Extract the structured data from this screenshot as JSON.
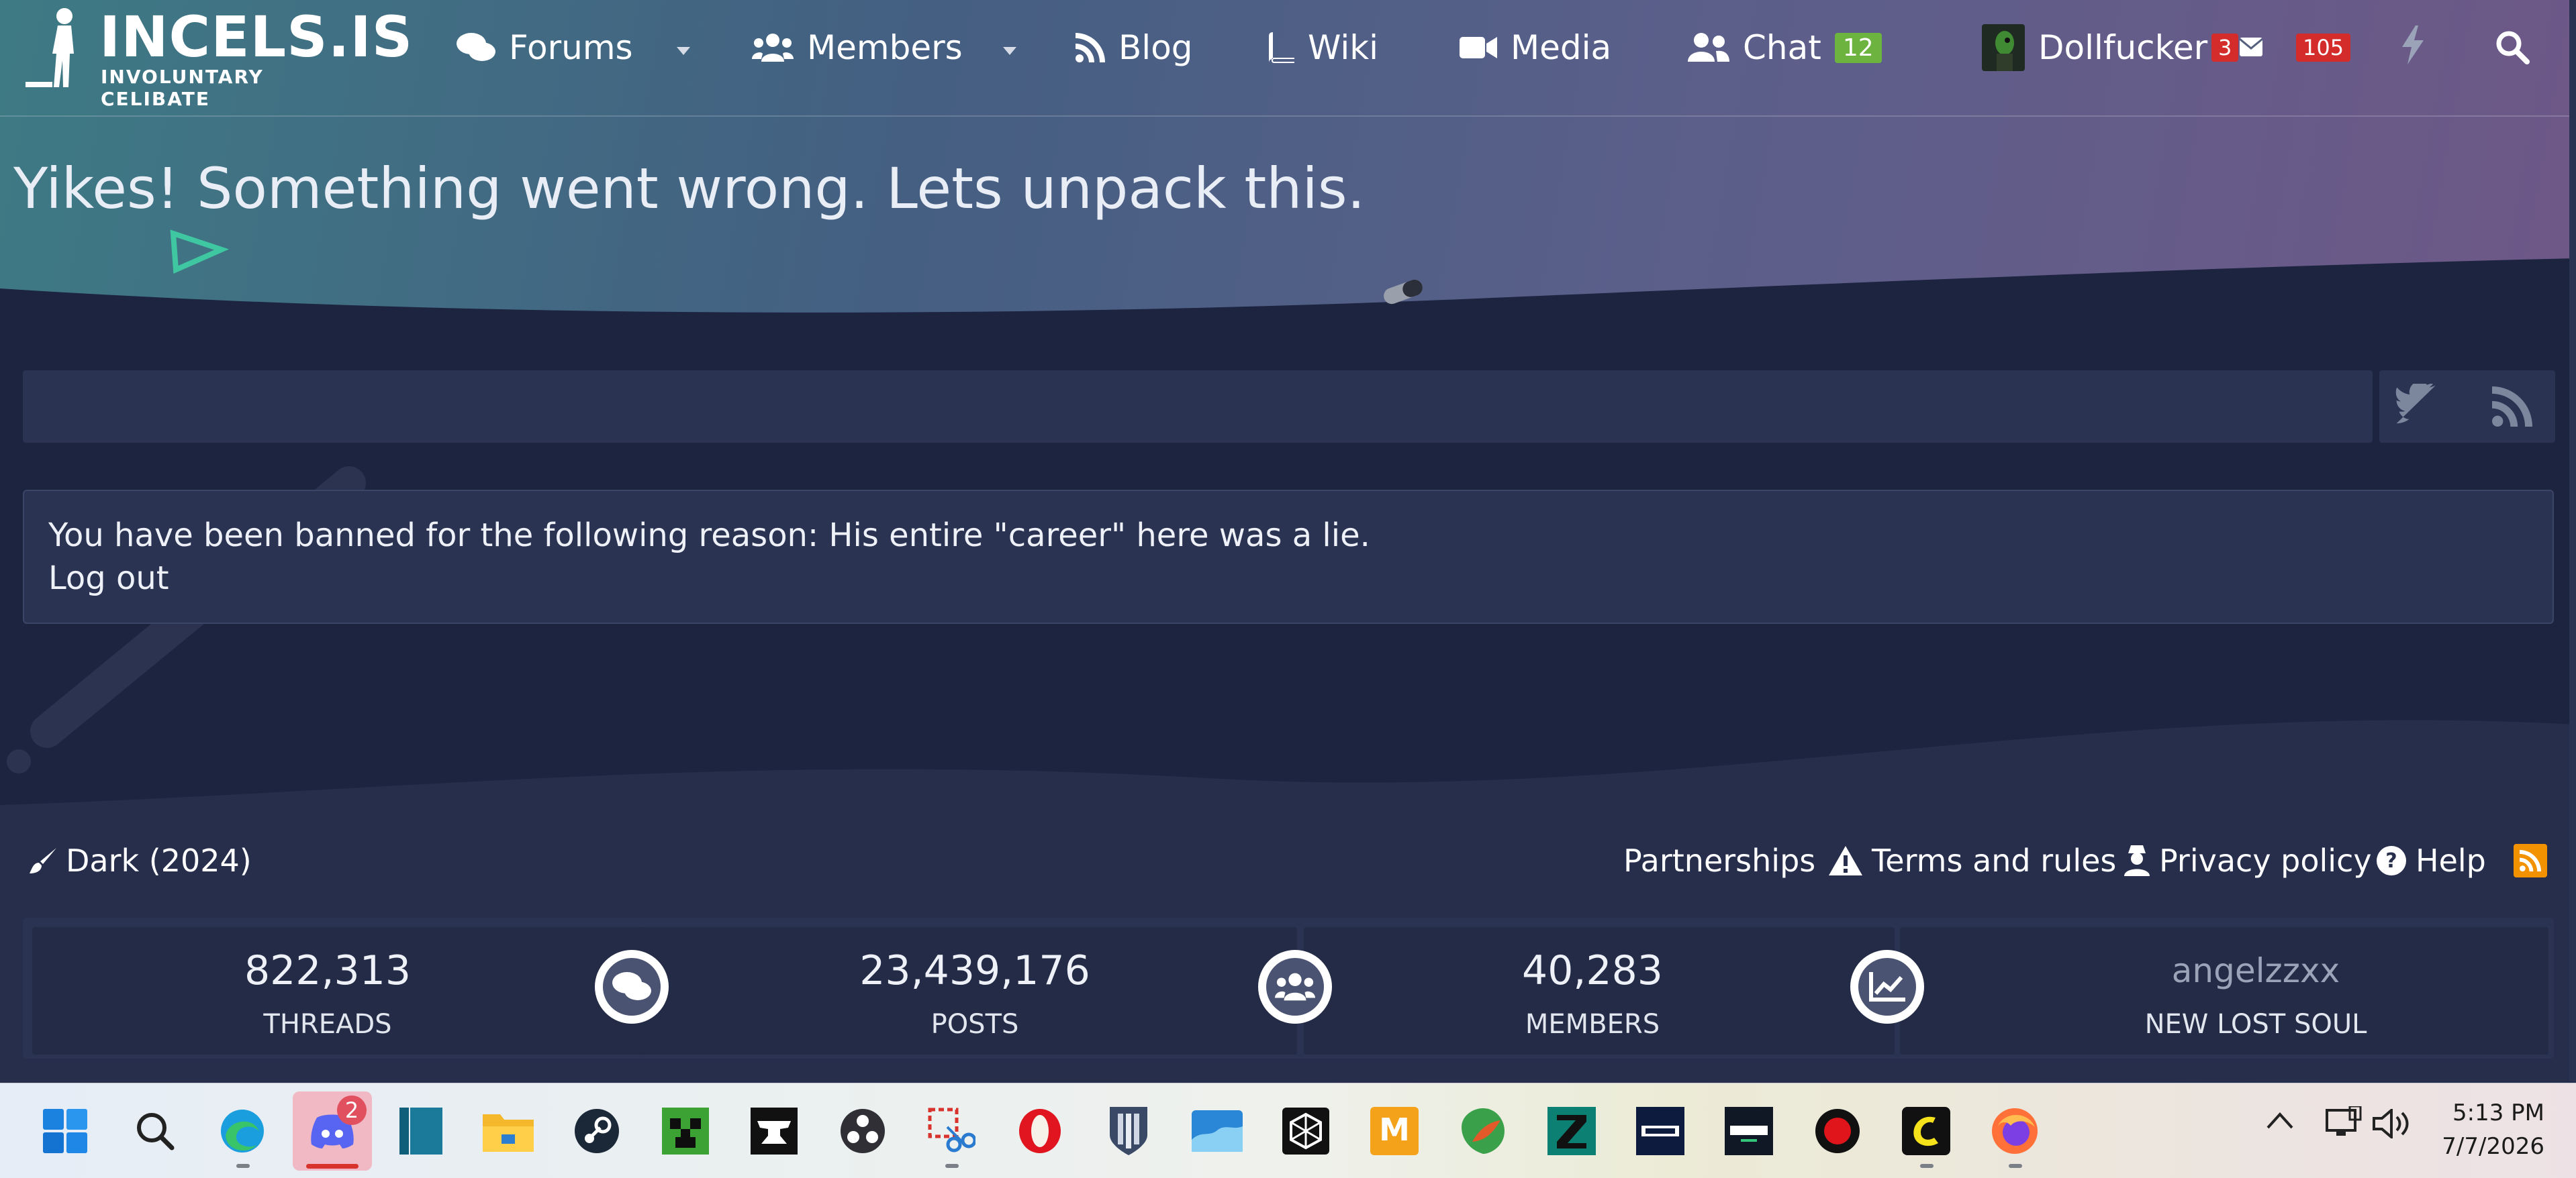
{
  "site": {
    "logo_title": "INCELS.IS",
    "logo_subtitle": "INVOLUNTARY CELIBATE"
  },
  "nav": {
    "forums": "Forums",
    "members": "Members",
    "blog": "Blog",
    "wiki": "Wiki",
    "media": "Media",
    "chat": "Chat",
    "chat_badge": "12",
    "username": "Dollfucker",
    "conversations_badge": "3",
    "alerts_badge": "105"
  },
  "page": {
    "title": "Yikes! Something went wrong. Lets unpack this."
  },
  "notice": {
    "text": "You have been banned for the following reason: His entire \"career\" here was a lie.",
    "logout": "Log out"
  },
  "footer": {
    "style": "Dark (2024)",
    "partnerships": "Partnerships",
    "terms": "Terms and rules",
    "privacy": "Privacy policy",
    "help": "Help"
  },
  "stats": [
    {
      "value": "822,313",
      "label": "THREADS"
    },
    {
      "value": "23,439,176",
      "label": "POSTS"
    },
    {
      "value": "40,283",
      "label": "MEMBERS"
    },
    {
      "value": "angelzzxx",
      "label": "NEW LOST SOUL"
    }
  ],
  "taskbar": {
    "discord_badge": "2",
    "time": "5:13 PM",
    "date": "7/7/2026"
  },
  "colors": {
    "accent_green": "#6db33f",
    "badge_red": "#d42b2b",
    "rss_orange": "#f39200",
    "panel_bg": "#2a3352",
    "page_bg": "#232b46"
  }
}
